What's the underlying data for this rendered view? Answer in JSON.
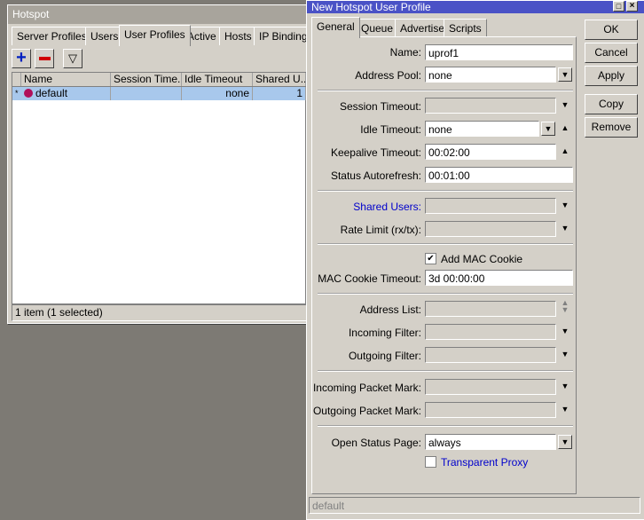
{
  "hotspot": {
    "title": "Hotspot",
    "tabs": [
      "Server Profiles",
      "Users",
      "User Profiles",
      "Active",
      "Hosts",
      "IP Bindings"
    ],
    "active_tab": "User Profiles",
    "toolbar": {
      "add": "add-icon",
      "remove": "remove-icon",
      "filter": "filter-icon"
    },
    "columns": [
      "Name",
      "Session Time...",
      "Idle Timeout",
      "Shared U..."
    ],
    "rows": [
      {
        "marker": "*",
        "name": "default",
        "session_timeout": "",
        "idle_timeout": "none",
        "shared_users": "1"
      }
    ],
    "status": "1 item (1 selected)"
  },
  "dialog": {
    "title": "New Hotspot User Profile",
    "tabs": [
      "General",
      "Queue",
      "Advertise",
      "Scripts"
    ],
    "buttons": {
      "ok": "OK",
      "cancel": "Cancel",
      "apply": "Apply",
      "copy": "Copy",
      "remove": "Remove"
    },
    "fields": {
      "name": {
        "label": "Name:",
        "value": "uprof1"
      },
      "address_pool": {
        "label": "Address Pool:",
        "value": "none"
      },
      "session_timeout": {
        "label": "Session Timeout:",
        "value": ""
      },
      "idle_timeout": {
        "label": "Idle Timeout:",
        "value": "none"
      },
      "keepalive_timeout": {
        "label": "Keepalive Timeout:",
        "value": "00:02:00"
      },
      "status_autorefresh": {
        "label": "Status Autorefresh:",
        "value": "00:01:00"
      },
      "shared_users": {
        "label": "Shared Users:",
        "value": ""
      },
      "rate_limit": {
        "label": "Rate Limit (rx/tx):",
        "value": ""
      },
      "add_mac_cookie": {
        "label": "Add MAC Cookie",
        "checked": true
      },
      "mac_cookie_timeout": {
        "label": "MAC Cookie Timeout:",
        "value": "3d 00:00:00"
      },
      "address_list": {
        "label": "Address List:",
        "value": ""
      },
      "incoming_filter": {
        "label": "Incoming Filter:",
        "value": ""
      },
      "outgoing_filter": {
        "label": "Outgoing Filter:",
        "value": ""
      },
      "incoming_packet_mark": {
        "label": "Incoming Packet Mark:",
        "value": ""
      },
      "outgoing_packet_mark": {
        "label": "Outgoing Packet Mark:",
        "value": ""
      },
      "open_status_page": {
        "label": "Open Status Page:",
        "value": "always"
      },
      "transparent_proxy": {
        "label": "Transparent Proxy",
        "checked": false
      }
    },
    "status": "default",
    "colors": {
      "title_active": "#4a52c6",
      "link_label": "#0000cc"
    }
  }
}
